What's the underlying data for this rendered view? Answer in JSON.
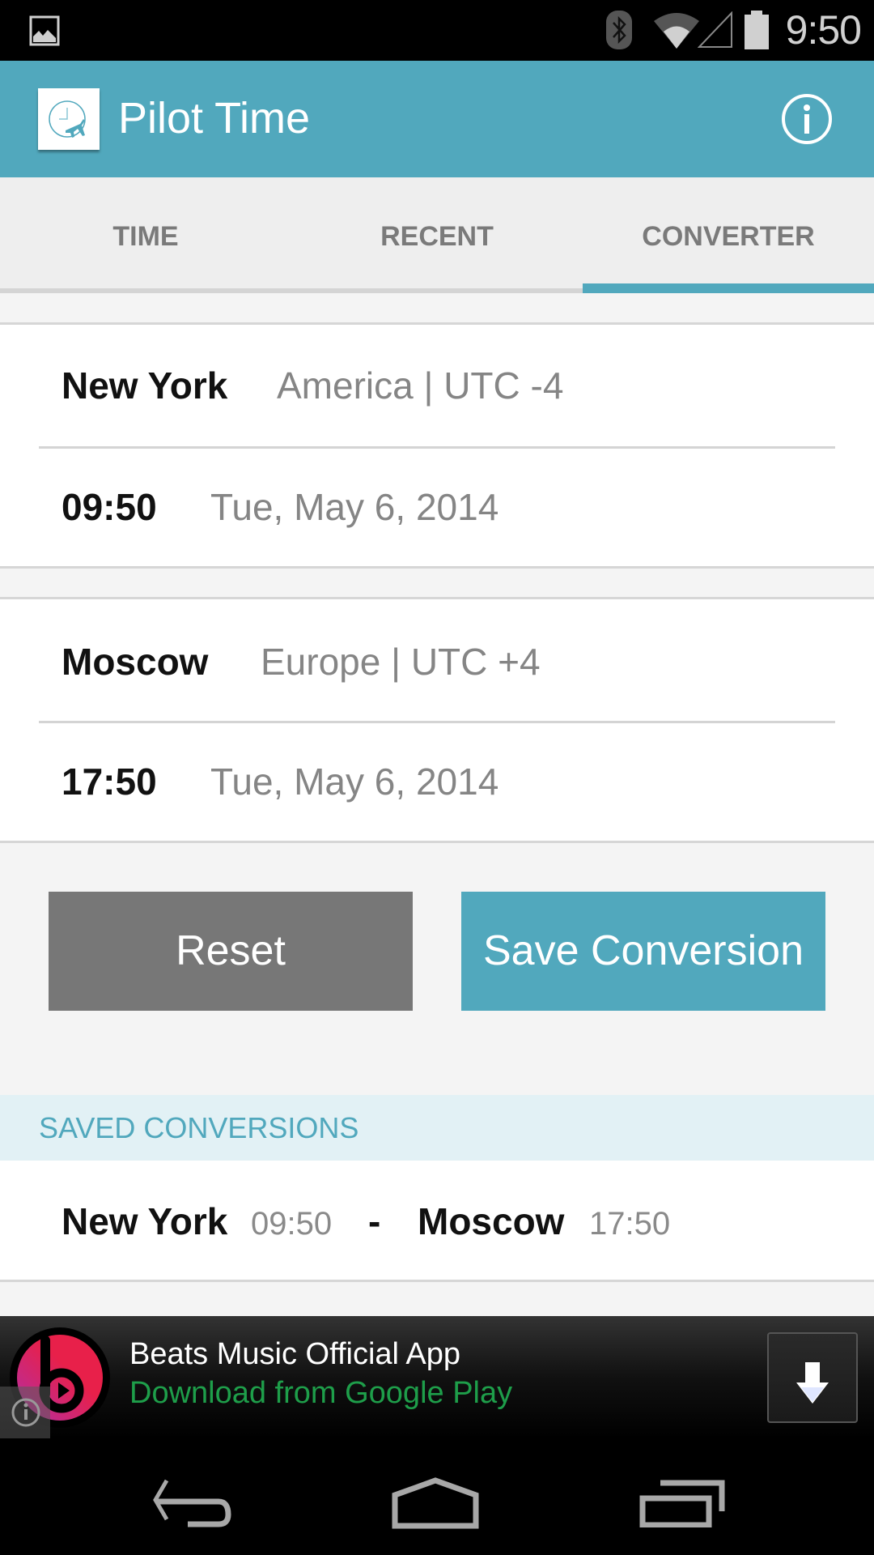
{
  "status_bar": {
    "time": "9:50",
    "icons": [
      "gallery-notification-icon",
      "bluetooth-icon",
      "wifi-icon",
      "cell-signal-icon",
      "battery-icon"
    ]
  },
  "app_bar": {
    "title": "Pilot Time",
    "logo_icon": "clock-plane-logo",
    "action_icon": "info-icon"
  },
  "tabs": [
    {
      "label": "TIME",
      "selected": false
    },
    {
      "label": "RECENT",
      "selected": false
    },
    {
      "label": "CONVERTER",
      "selected": true
    }
  ],
  "converter": {
    "from": {
      "city": "New York",
      "region": "America | UTC -4",
      "time": "09:50",
      "date": "Tue, May 6, 2014"
    },
    "to": {
      "city": "Moscow",
      "region": "Europe | UTC +4",
      "time": "17:50",
      "date": "Tue, May 6, 2014"
    },
    "reset_label": "Reset",
    "save_label": "Save Conversion"
  },
  "saved": {
    "header": "SAVED CONVERSIONS",
    "items": [
      {
        "from_city": "New York",
        "from_time": "09:50",
        "separator": "-",
        "to_city": "Moscow",
        "to_time": "17:50"
      }
    ]
  },
  "ad": {
    "title": "Beats Music Official App",
    "subtitle": "Download from Google Play",
    "icon": "beats-logo-icon",
    "action_icon": "download-arrow-icon",
    "badge_icon": "ad-info-icon"
  },
  "nav_bar": {
    "buttons": [
      "back-icon",
      "home-icon",
      "recents-icon"
    ]
  },
  "colors": {
    "accent": "#51a8bd",
    "reset_button": "#777777",
    "ad_subtitle": "#1e9e4a"
  }
}
